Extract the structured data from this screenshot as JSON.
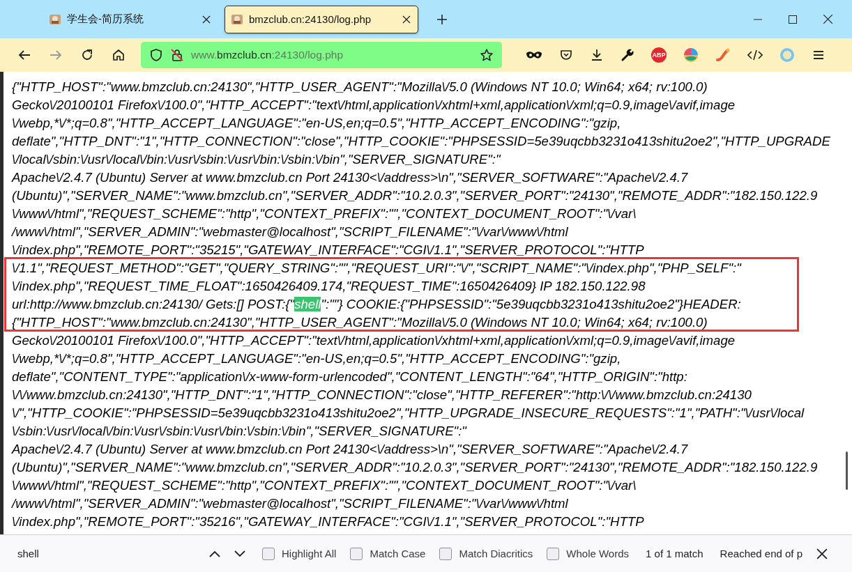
{
  "tabs": [
    {
      "title": "学生会-简历系统",
      "selected": false
    },
    {
      "title": "bmzclub.cn:24130/log.php",
      "selected": true
    }
  ],
  "navigation": {
    "back_disabled": false,
    "forward_disabled": true
  },
  "address_bar": {
    "prefix": "www.",
    "domain": "bmzclub.cn",
    "suffix": ":24130/log.php"
  },
  "extensions": {
    "adblock_label": "ABP"
  },
  "page": {
    "annotation_visible": true,
    "lines": [
      {
        "kind": "plain",
        "text": "{\"HTTP_HOST\":\"www.bmzclub.cn:24130\",\"HTTP_USER_AGENT\":\"Mozilla\\/5.0 (Windows NT 10.0; Win64; x64; rv:100.0)"
      },
      {
        "kind": "plain",
        "text": "Gecko\\/20100101 Firefox\\/100.0\",\"HTTP_ACCEPT\":\"text\\/html,application\\/xhtml+xml,application\\/xml;q=0.9,image\\/avif,image"
      },
      {
        "kind": "plain",
        "text": "\\/webp,*\\/*;q=0.8\",\"HTTP_ACCEPT_LANGUAGE\":\"en-US,en;q=0.5\",\"HTTP_ACCEPT_ENCODING\":\"gzip,"
      },
      {
        "kind": "plain",
        "text": "deflate\",\"HTTP_DNT\":\"1\",\"HTTP_CONNECTION\":\"close\",\"HTTP_COOKIE\":\"PHPSESSID=5e39uqcbb3231o413shitu2oe2\",\"HTTP_UPGRADE"
      },
      {
        "kind": "plain",
        "text": "\\/local\\/sbin:\\/usr\\/local\\/bin:\\/usr\\/sbin:\\/usr\\/bin:\\/sbin:\\/bin\",\"SERVER_SIGNATURE\":\""
      },
      {
        "kind": "plain",
        "text": "Apache\\/2.4.7 (Ubuntu) Server at www.bmzclub.cn Port 24130<\\/address>\\n\",\"SERVER_SOFTWARE\":\"Apache\\/2.4.7"
      },
      {
        "kind": "plain",
        "text": "(Ubuntu)\",\"SERVER_NAME\":\"www.bmzclub.cn\",\"SERVER_ADDR\":\"10.2.0.3\",\"SERVER_PORT\":\"24130\",\"REMOTE_ADDR\":\"182.150.122.9"
      },
      {
        "kind": "plain",
        "text": "\\/www\\/html\",\"REQUEST_SCHEME\":\"http\",\"CONTEXT_PREFIX\":\"\",\"CONTEXT_DOCUMENT_ROOT\":\"\\/var\\"
      },
      {
        "kind": "plain",
        "text": "/www\\/html\",\"SERVER_ADMIN\":\"webmaster@localhost\",\"SCRIPT_FILENAME\":\"\\/var\\/www\\/html"
      },
      {
        "kind": "plain",
        "text": "\\/index.php\",\"REMOTE_PORT\":\"35215\",\"GATEWAY_INTERFACE\":\"CGI\\/1.1\",\"SERVER_PROTOCOL\":\"HTTP"
      },
      {
        "kind": "plain",
        "text": "\\/1.1\",\"REQUEST_METHOD\":\"GET\",\"QUERY_STRING\":\"\",\"REQUEST_URI\":\"\\/\",\"SCRIPT_NAME\":\"\\/index.php\",\"PHP_SELF\":\""
      },
      {
        "kind": "plain",
        "text": "\\/index.php\",\"REQUEST_TIME_FLOAT\":1650426409.174,\"REQUEST_TIME\":1650426409} IP 182.150.122.98"
      },
      {
        "kind": "match",
        "before": "url:http://www.bmzclub.cn:24130/ Gets:[] POST:{\"",
        "match": "shell",
        "after": "\":\"\"} COOKIE:{\"PHPSESSID\":\"5e39uqcbb3231o413shitu2oe2\"}HEADER:"
      },
      {
        "kind": "plain",
        "text": "{\"HTTP_HOST\":\"www.bmzclub.cn:24130\",\"HTTP_USER_AGENT\":\"Mozilla\\/5.0 (Windows NT 10.0; Win64; x64; rv:100.0)"
      },
      {
        "kind": "plain",
        "text": "Gecko\\/20100101 Firefox\\/100.0\",\"HTTP_ACCEPT\":\"text\\/html,application\\/xhtml+xml,application\\/xml;q=0.9,image\\/avif,image"
      },
      {
        "kind": "plain",
        "text": "\\/webp,*\\/*;q=0.8\",\"HTTP_ACCEPT_LANGUAGE\":\"en-US,en;q=0.5\",\"HTTP_ACCEPT_ENCODING\":\"gzip,"
      },
      {
        "kind": "plain",
        "text": "deflate\",\"CONTENT_TYPE\":\"application\\/x-www-form-urlencoded\",\"CONTENT_LENGTH\":\"64\",\"HTTP_ORIGIN\":\"http:"
      },
      {
        "kind": "plain",
        "text": "\\/\\/www.bmzclub.cn:24130\",\"HTTP_DNT\":\"1\",\"HTTP_CONNECTION\":\"close\",\"HTTP_REFERER\":\"http:\\/\\/www.bmzclub.cn:24130"
      },
      {
        "kind": "plain",
        "text": "\\/\",\"HTTP_COOKIE\":\"PHPSESSID=5e39uqcbb3231o413shitu2oe2\",\"HTTP_UPGRADE_INSECURE_REQUESTS\":\"1\",\"PATH\":\"\\/usr\\/local"
      },
      {
        "kind": "plain",
        "text": "\\/sbin:\\/usr\\/local\\/bin:\\/usr\\/sbin:\\/usr\\/bin:\\/sbin:\\/bin\",\"SERVER_SIGNATURE\":\""
      },
      {
        "kind": "plain",
        "text": "Apache\\/2.4.7 (Ubuntu) Server at www.bmzclub.cn Port 24130<\\/address>\\n\",\"SERVER_SOFTWARE\":\"Apache\\/2.4.7"
      },
      {
        "kind": "plain",
        "text": "(Ubuntu)\",\"SERVER_NAME\":\"www.bmzclub.cn\",\"SERVER_ADDR\":\"10.2.0.3\",\"SERVER_PORT\":\"24130\",\"REMOTE_ADDR\":\"182.150.122.9"
      },
      {
        "kind": "plain",
        "text": "\\/www\\/html\",\"REQUEST_SCHEME\":\"http\",\"CONTEXT_PREFIX\":\"\",\"CONTEXT_DOCUMENT_ROOT\":\"\\/var\\"
      },
      {
        "kind": "plain",
        "text": "/www\\/html\",\"SERVER_ADMIN\":\"webmaster@localhost\",\"SCRIPT_FILENAME\":\"\\/var\\/www\\/html"
      },
      {
        "kind": "plain",
        "text": "\\/index.php\",\"REMOTE_PORT\":\"35216\",\"GATEWAY_INTERFACE\":\"CGI\\/1.1\",\"SERVER_PROTOCOL\":\"HTTP"
      }
    ]
  },
  "find_bar": {
    "query": "shell",
    "options": [
      {
        "label": "Highlight All",
        "checked": false
      },
      {
        "label": "Match Case",
        "checked": false
      },
      {
        "label": "Match Diacritics",
        "checked": false
      },
      {
        "label": "Whole Words",
        "checked": false
      }
    ],
    "result": "1 of 1 match",
    "status": "Reached end of p"
  }
}
